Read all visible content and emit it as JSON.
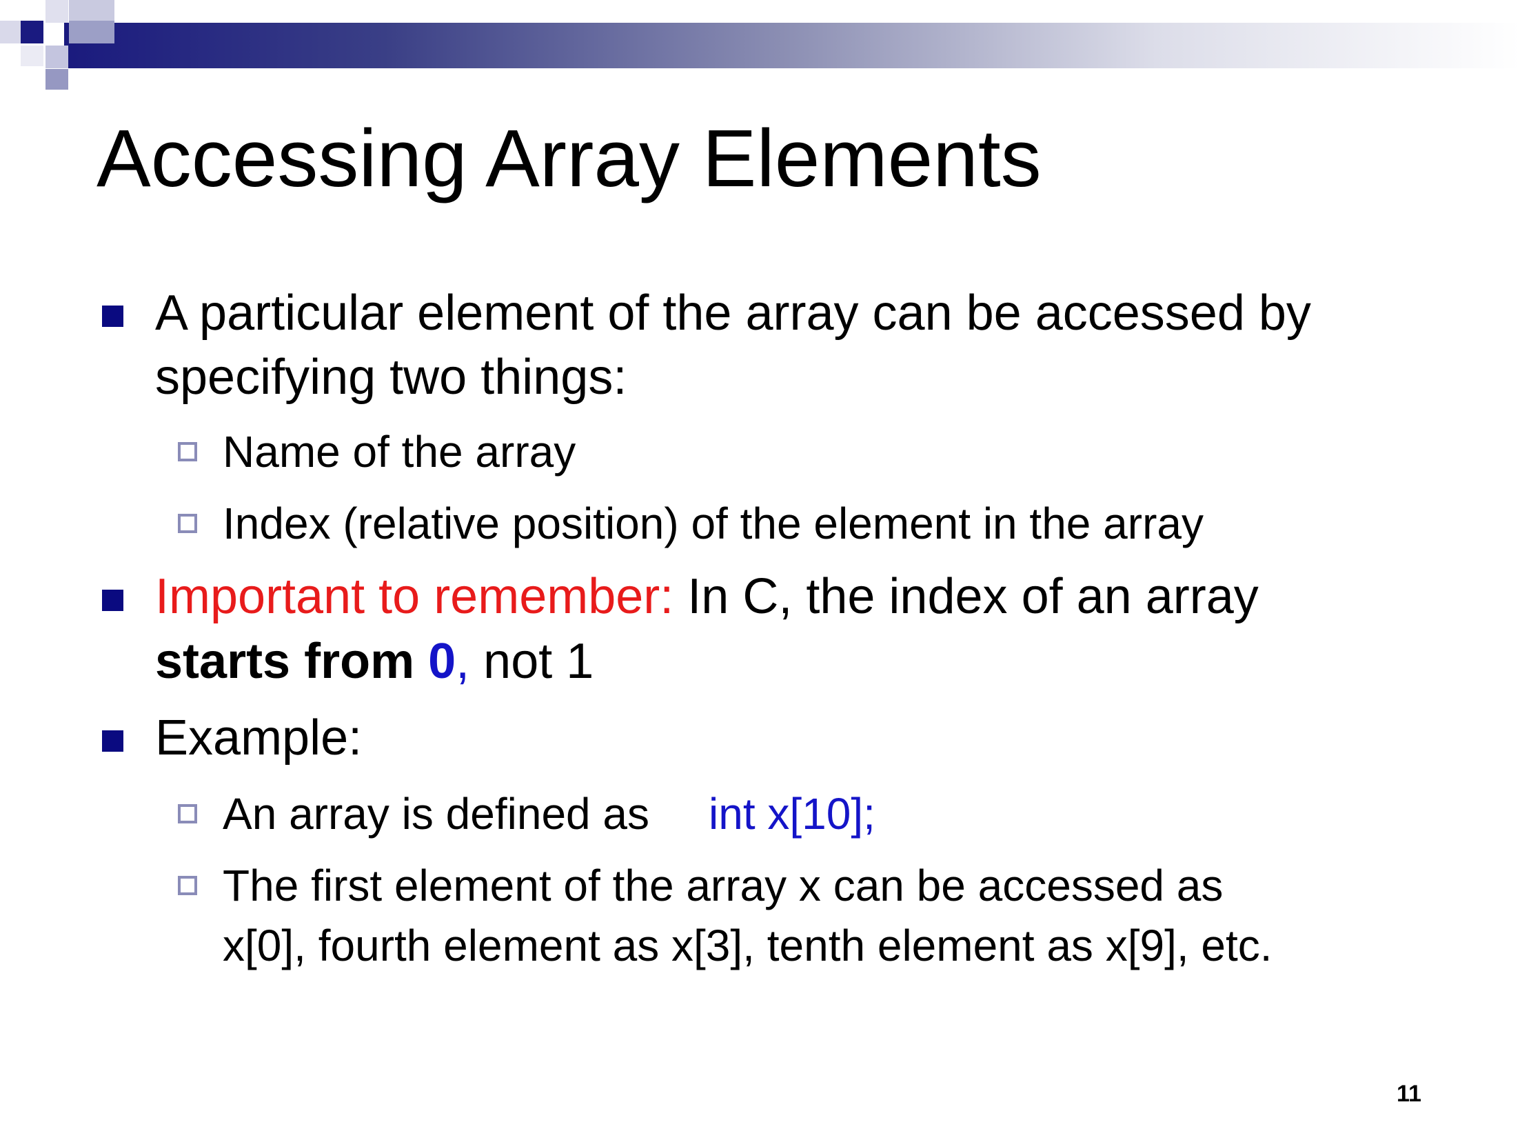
{
  "slide": {
    "title": "Accessing Array Elements",
    "page_number": "11"
  },
  "bullets": {
    "b1_line1": "A particular element of the array can be accessed by",
    "b1_line2": "specifying two things:",
    "b1_sub1": "Name of the array",
    "b1_sub2": "Index (relative position) of the element in the array",
    "b2_highlight": "Important to remember:",
    "b2_line1_rest": " In C, the index of an array",
    "b2_bold": "starts from ",
    "b2_zero": "0",
    "b2_comma": ",",
    "b2_tail": " not 1",
    "b3_label": "Example:",
    "b3_sub1_text": "An array is defined as",
    "b3_sub1_code": "int  x[10];",
    "b3_sub2_line1": "The first element of the array x can be accessed as",
    "b3_sub2_line2": "x[0], fourth element as x[3], tenth element as x[9], etc."
  },
  "colors": {
    "highlight_red": "#e81b1b",
    "code_blue": "#1414c8",
    "bullet_navy": "#0a0a80",
    "sub_bullet_outline": "#8a8cb8"
  }
}
